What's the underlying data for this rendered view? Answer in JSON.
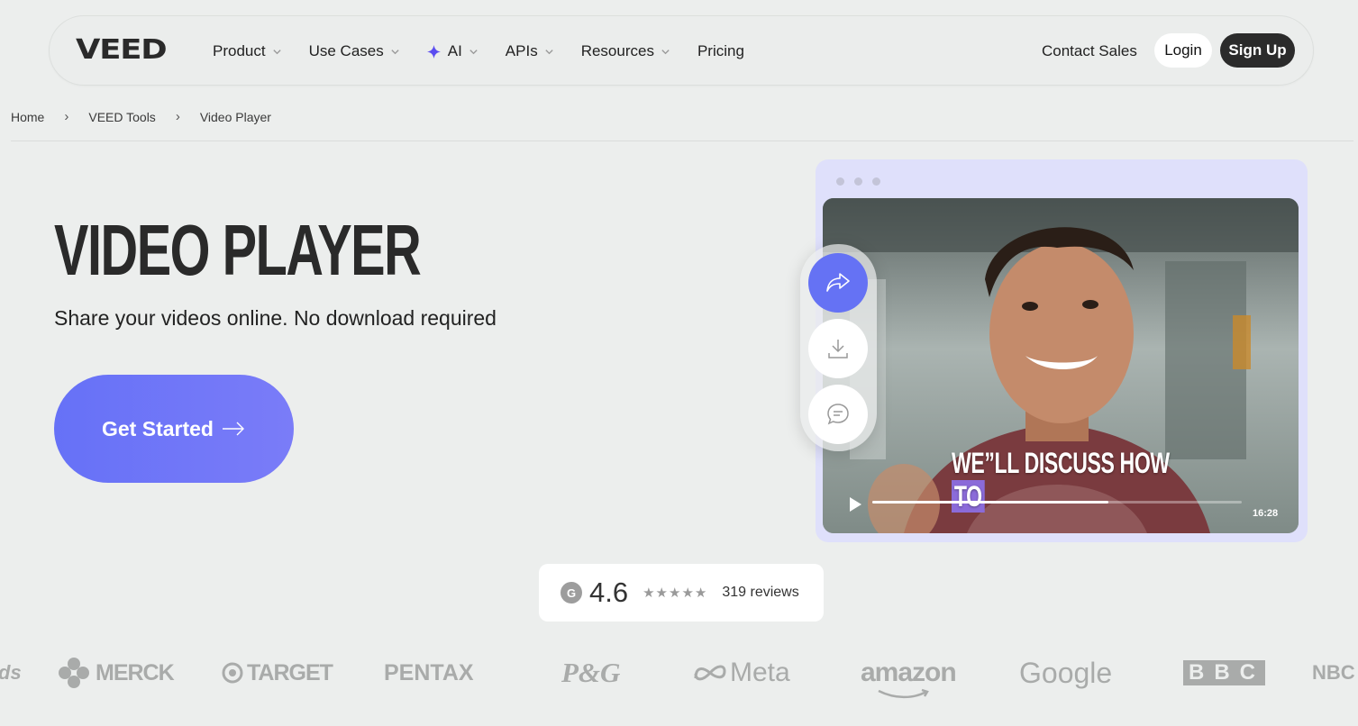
{
  "nav": {
    "logo": "VEED",
    "menu": [
      "Product",
      "Use Cases",
      "AI",
      "APIs",
      "Resources",
      "Pricing"
    ],
    "contact": "Contact Sales",
    "login": "Login",
    "signup": "Sign Up"
  },
  "breadcrumb": [
    "Home",
    "VEED Tools",
    "Video Player"
  ],
  "hero": {
    "title": "VIDEO PLAYER",
    "subtitle": "Share your videos online. No download required",
    "cta": "Get Started"
  },
  "video": {
    "caption_main": "WE”LL DISCUSS HOW",
    "caption_highlight": "TO",
    "time": "16:28",
    "progress": 0.64
  },
  "rating": {
    "score": "4.6",
    "stars": "★★★★★",
    "reviews": "319 reviews"
  },
  "logos": [
    "ds",
    "MERCK",
    "TARGET",
    "PENTAX",
    "P&G",
    "Meta",
    "amazon",
    "Google",
    "BBC",
    "NBC"
  ],
  "colors": {
    "accent": "#6671f7",
    "dark": "#2b2b2b",
    "card": "#dfe0fb"
  }
}
